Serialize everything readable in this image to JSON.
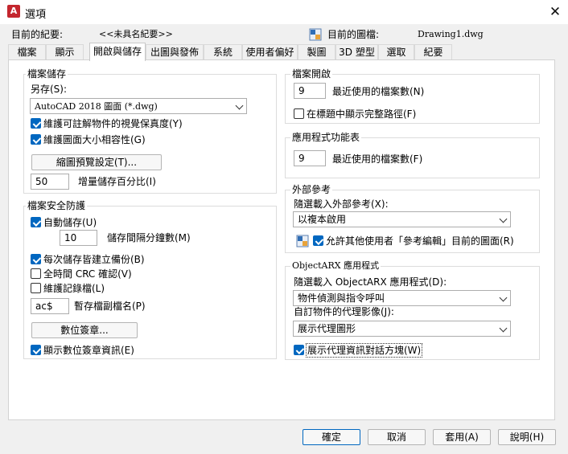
{
  "window": {
    "title": "選項",
    "close_glyph": "✕",
    "app_glyph": "A"
  },
  "profile": {
    "label": "目前的紀要:",
    "value": "<<未具名紀要>>"
  },
  "drawing": {
    "label": "目前的圖檔:",
    "value": "Drawing1.dwg"
  },
  "tabs": [
    "檔案",
    "顯示",
    "開啟與儲存",
    "出圖與發佈",
    "系統",
    "使用者偏好",
    "製圖",
    "3D 塑型",
    "選取",
    "紀要"
  ],
  "active_tab": "開啟與儲存",
  "file_save": {
    "group_label": "檔案儲存",
    "saveas_label": "另存(S):",
    "saveas_value": "AutoCAD 2018 圖面 (*.dwg)",
    "maintain_visual_label": "維護可註解物件的視覺保真度(Y)",
    "maintain_visual_checked": true,
    "maintain_size_label": "維護圖面大小相容性(G)",
    "maintain_size_checked": true,
    "thumbnail_button": "縮圖預覽設定(T)...",
    "incremental_value": "50",
    "incremental_label": "增量儲存百分比(I)"
  },
  "safety": {
    "group_label": "檔案安全防護",
    "autosave_label": "自動儲存(U)",
    "autosave_checked": true,
    "minutes_value": "10",
    "minutes_label": "儲存間隔分鐘數(M)",
    "backup_label": "每次儲存皆建立備份(B)",
    "backup_checked": true,
    "crc_label": "全時間 CRC 確認(V)",
    "crc_checked": false,
    "log_label": "維護記錄檔(L)",
    "log_checked": false,
    "temp_ext_value": "ac$",
    "temp_ext_label": "暫存檔副檔名(P)",
    "digital_sig_button": "數位簽章...",
    "show_sig_label": "顯示數位簽章資訊(E)",
    "show_sig_checked": true
  },
  "file_open": {
    "group_label": "檔案開啟",
    "recent_value": "9",
    "recent_label": "最近使用的檔案數(N)",
    "fullpath_label": "在標題中顯示完整路徑(F)",
    "fullpath_checked": false
  },
  "app_menu": {
    "group_label": "應用程式功能表",
    "recent_value": "9",
    "recent_label": "最近使用的檔案數(F)"
  },
  "xref": {
    "group_label": "外部參考",
    "demand_label": "隨選載入外部參考(X):",
    "demand_value": "以複本啟用",
    "allow_edit_label": "允許其他使用者「參考編輯」目前的圖面(R)",
    "allow_edit_checked": true
  },
  "arx": {
    "group_label": "ObjectARX 應用程式",
    "demand_label": "隨選載入 ObjectARX 應用程式(D):",
    "demand_value": "物件偵測與指令呼叫",
    "proxy_label": "自訂物件的代理影像(J):",
    "proxy_value": "展示代理圖形",
    "show_proxy_label": "展示代理資訊對話方塊(W)",
    "show_proxy_checked": true
  },
  "footer": {
    "ok": "確定",
    "cancel": "取消",
    "apply": "套用(A)",
    "help": "說明(H)"
  }
}
